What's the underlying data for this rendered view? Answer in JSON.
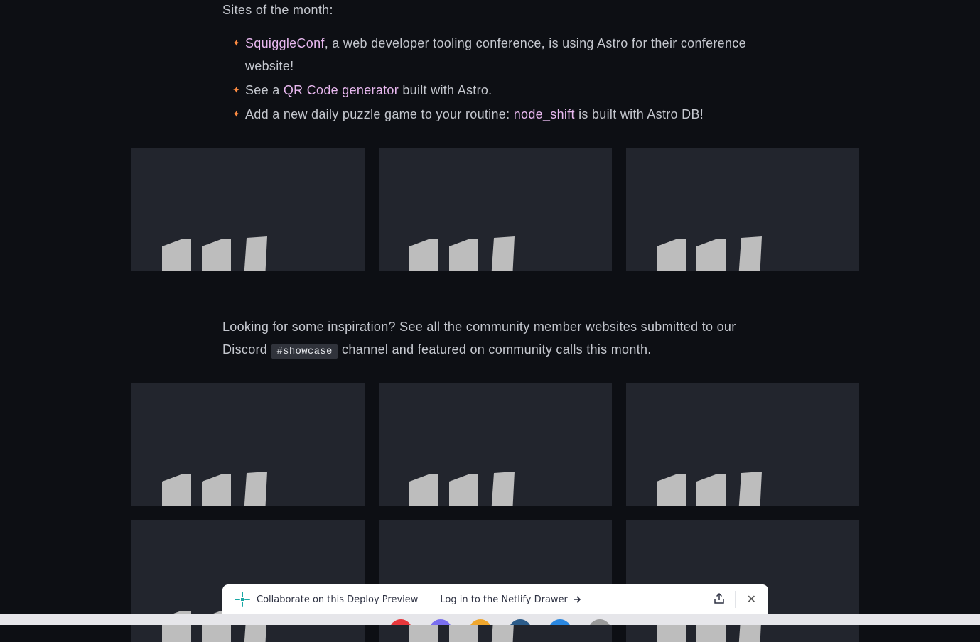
{
  "intro": "Sites of the month:",
  "sites": [
    {
      "link": "SquiggleConf",
      "before": "",
      "after": ", a web developer tooling conference, is using Astro for their conference website!"
    },
    {
      "link": "QR Code generator",
      "before": "See a ",
      "after": " built with Astro."
    },
    {
      "link": "node_shift",
      "before": "Add a new daily puzzle game to your routine: ",
      "after": " is built with Astro DB!"
    }
  ],
  "showcase": {
    "before": "Looking for some inspiration? See all the community member websites submitted to our Discord ",
    "code": "#showcase",
    "after": " channel and featured on community calls this month."
  },
  "drawer": {
    "collaborate": "Collaborate on this Deploy Preview",
    "login": "Log in to the Netlify Drawer",
    "icons": [
      "netlify-logo",
      "arrow-right-icon",
      "share-icon",
      "close-icon"
    ]
  },
  "bottom_dock_colors": [
    "#e8373c",
    "#7a6ff0",
    "#f0a72d",
    "#2c5c8a",
    "#2a87e0",
    "#9a9a9a"
  ]
}
